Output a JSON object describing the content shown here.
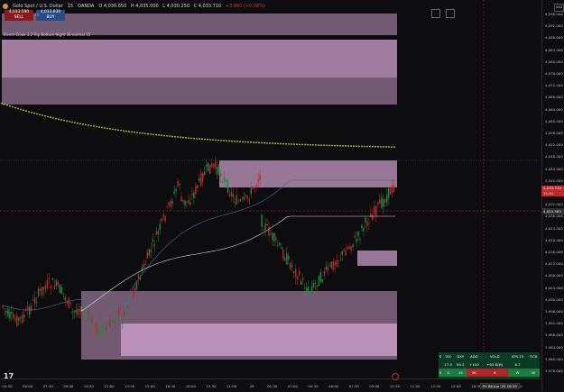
{
  "header": {
    "symbol": "Gold Spot / U.S. Dollar",
    "timeframe": "15",
    "exchange": "OANDA",
    "ohlc": [
      "O 4,030.650",
      "H 4,035.000",
      "L 4,030.250",
      "C 4,033.710",
      "+3.060 (+0.08%)"
    ],
    "sell_price": "4,033.590",
    "sell_label": "SELL",
    "buy_price": "4,033.830",
    "buy_label": "BUY",
    "spread": "24"
  },
  "indicator_label": "Elvers Cloak 3.2 Top Bottom Night 30 normal 15",
  "currency_button": "USD",
  "price_labels": [
    "4,096.000",
    "4,092.000",
    "4,088.000",
    "4,084.000",
    "4,080.000",
    "4,076.000",
    "4,072.000",
    "4,068.000",
    "4,064.000",
    "4,060.000",
    "4,056.000",
    "4,052.000",
    "4,048.000",
    "4,044.000",
    "4,040.000",
    "4,036.000",
    "4,032.000",
    "4,028.000",
    "4,024.000",
    "4,020.000",
    "4,016.000",
    "4,012.000",
    "4,008.000",
    "4,004.000",
    "4,000.000",
    "3,996.000",
    "3,992.000",
    "3,988.000",
    "3,984.000",
    "3,980.000",
    "3,976.000"
  ],
  "current_price_tag": "4,033.710",
  "current_price_countdown": "11:41",
  "crosshair_price_tag": "4,025.583",
  "time_labels": [
    "04:30",
    "06:00",
    "07:30",
    "09:00",
    "10:30",
    "12:00",
    "13:30",
    "15:00",
    "16:30",
    "18:00",
    "19:30",
    "21:00",
    "26",
    "01:30",
    "03:00",
    "04:30",
    "06:00",
    "07:30",
    "09:00",
    "10:30",
    "12:00",
    "13:30",
    "15:00",
    "16:30",
    "18:00",
    "19:30"
  ],
  "crosshair_time_tag": "Fri 06 Jun '25  16:15",
  "stats": {
    "headers": [
      "S",
      "VIX",
      "DXY",
      "ADD",
      "VOLD",
      "ATR-15",
      "TICK"
    ],
    "row2": [
      "17.5",
      "99.3",
      "+150",
      "+65 B(M)",
      "8.7",
      ""
    ],
    "row3": [
      "3",
      "S",
      "15",
      "5K",
      "6",
      "W",
      "W"
    ],
    "row3_colors": [
      "green",
      "green",
      "green",
      "red",
      "red",
      "green",
      "green"
    ]
  },
  "colors": {
    "bull_candle": "#1e8e3e",
    "bear_candle": "#c0292c",
    "zone_fill": "#c79ac4",
    "background": "#0d0d0f",
    "dots": "#c8d02a"
  },
  "icons": [
    "tradingview-logo-icon",
    "settings-icon",
    "screenshot-icon",
    "fullscreen-icon"
  ]
}
